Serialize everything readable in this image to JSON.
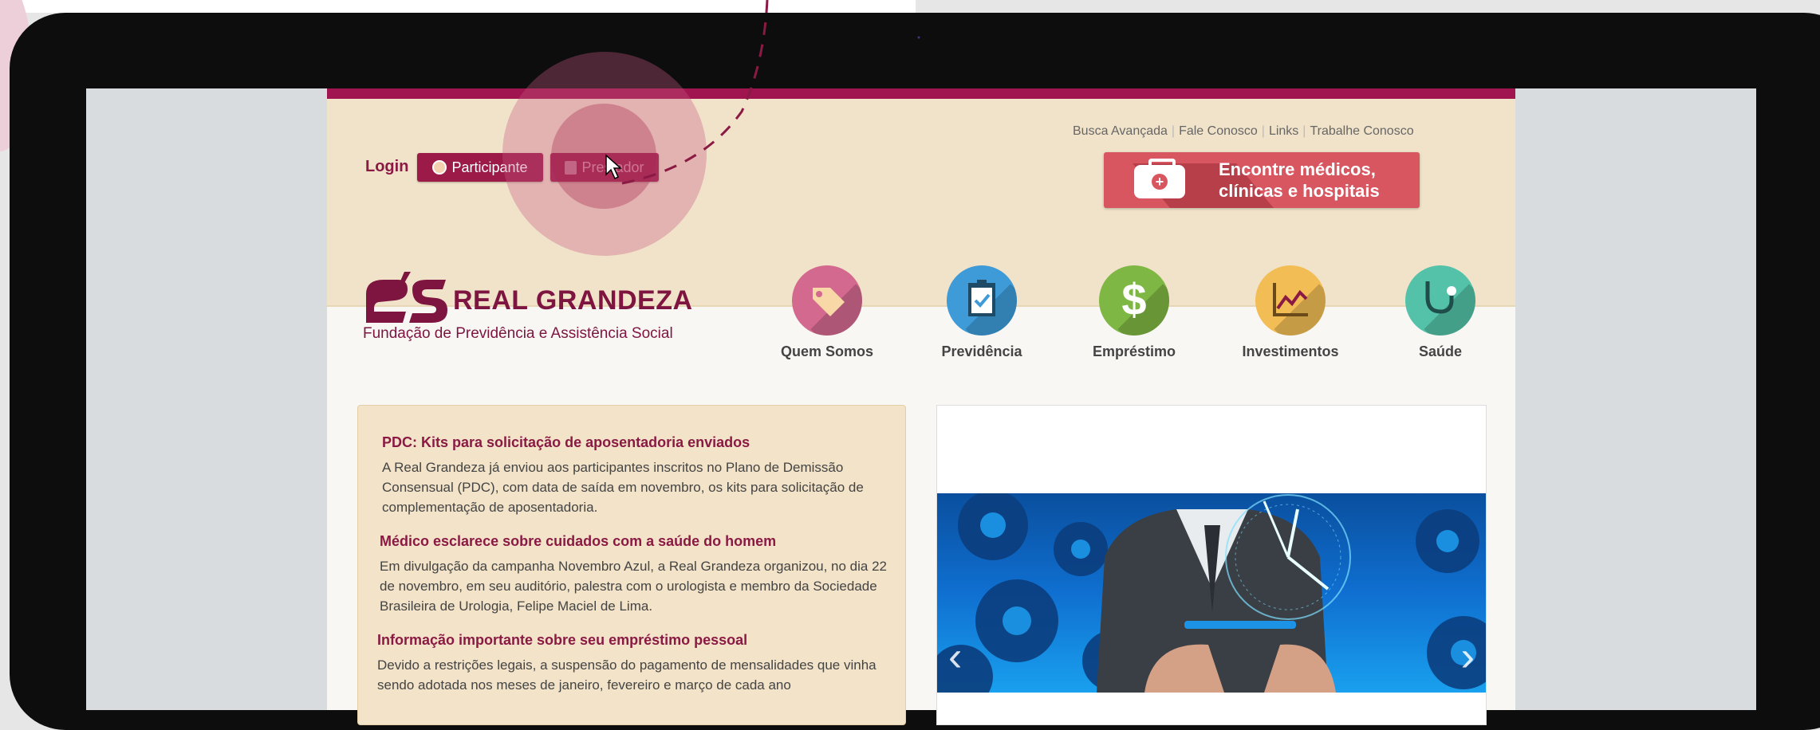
{
  "header": {
    "login_label": "Login",
    "participante_label": "Participante",
    "prestador_label": "Prestador",
    "top_links": [
      "Busca Avançada",
      "Fale Conosco",
      "Links",
      "Trabalhe Conosco"
    ],
    "find_line1": "Encontre médicos,",
    "find_line2": "clínicas e hospitais"
  },
  "logo": {
    "name": "REAL GRANDEZA",
    "subtitle": "Fundação de Previdência e Assistência Social"
  },
  "nav": [
    {
      "label": "Quem Somos",
      "icon": "tag-icon",
      "color": "#d4698f"
    },
    {
      "label": "Previdência",
      "icon": "clipboard-check-icon",
      "color": "#3e9bd8"
    },
    {
      "label": "Empréstimo",
      "icon": "dollar-icon",
      "color": "#7fb744"
    },
    {
      "label": "Investimentos",
      "icon": "line-chart-icon",
      "color": "#f2bd55"
    },
    {
      "label": "Saúde",
      "icon": "stethoscope-icon",
      "color": "#54c2a8"
    }
  ],
  "news": [
    {
      "title": "PDC: Kits para solicitação de aposentadoria enviados",
      "body": "A Real Grandeza já enviou aos participantes inscritos no Plano de Demissão Consensual (PDC), com data de saída em novembro, os kits para solicitação de complementação de aposentadoria."
    },
    {
      "title": "Médico esclarece sobre cuidados com a saúde do homem",
      "body": "Em divulgação da campanha Novembro Azul, a Real Grandeza organizou, no dia 22 de novembro, em seu auditório, palestra com o urologista e membro da Sociedade Brasileira de Urologia, Felipe Maciel de Lima."
    },
    {
      "title": "Informação importante sobre seu empréstimo pessoal",
      "body": "Devido a restrições legais, a suspensão do pagamento de mensalidades que vinha sendo adotada nos meses de janeiro, fevereiro e março de cada ano"
    }
  ],
  "carousel": {
    "prev": "‹",
    "next": "›"
  },
  "colors": {
    "brand": "#a0154f",
    "header_bg": "#f1e3c9",
    "find_button": "#d85660"
  }
}
